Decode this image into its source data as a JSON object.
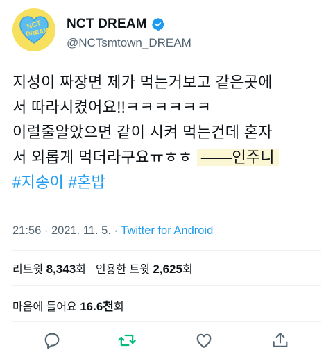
{
  "profile": {
    "display_name": "NCT DREAM",
    "handle": "@NCTsmtown_DREAM",
    "avatar_logo_text": "NCT DREAM",
    "colors": {
      "avatar_bg": "#f6e05e",
      "logo": "#5bbcf0",
      "verified": "#1d9bf0"
    }
  },
  "tweet": {
    "lines": [
      "지성이 짜장면 제가 먹는거보고 같은곳에",
      "서 따라시켰어요!!ㅋㅋㅋㅋㅋㅋ",
      "이럴줄알았으면 같이 시켜 먹는건데 혼자",
      "서 외롭게 먹더라구요ㅠㅎㅎ "
    ],
    "signature": "——인주니",
    "hashtags": [
      "#지송이",
      "#혼밥"
    ]
  },
  "meta": {
    "time": "21:56",
    "separator1": " · ",
    "date": "2021. 11. 5.",
    "separator2": " · ",
    "source": "Twitter for Android"
  },
  "stats": {
    "retweets_label": "리트윗",
    "retweets": "8,343",
    "retweets_unit": "회",
    "quotes_label": "인용한 트윗",
    "quotes": "2,625",
    "quotes_unit": "회",
    "likes_label": "마음에 들어요",
    "likes": "16.6천",
    "likes_unit": "회"
  },
  "actions": {
    "icons": [
      "reply-icon",
      "retweet-icon",
      "like-icon",
      "share-icon"
    ],
    "colors": {
      "default": "#536471",
      "retweet": "#00ba7c"
    }
  }
}
